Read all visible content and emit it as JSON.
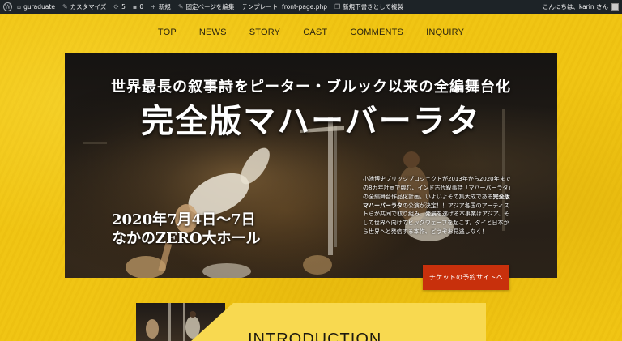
{
  "admin_bar": {
    "site_name": "guraduate",
    "customize": "カスタマイズ",
    "updates": "5",
    "comments": "0",
    "new": "新規",
    "edit_page": "固定ページを編集",
    "template": "テンプレート: front-page.php",
    "duplicate": "新規下書きとして複製",
    "greeting": "こんにちは、karin さん"
  },
  "nav": [
    "TOP",
    "NEWS",
    "STORY",
    "CAST",
    "COMMENTS",
    "INQUIRY"
  ],
  "hero": {
    "subtitle": "世界最長の叙事詩をピーター・ブルック以来の全編舞台化",
    "title": "完全版マハーバーラタ",
    "date_line1": "2020年7月4日〜7日",
    "date_line2": "なかのZERO大ホール",
    "desc_part1": "小池博史ブリッジプロジェクトが2013年から2020年までの8カ年計画で臨む、インド古代叙事詩「マハーバーラタ」の全編舞台作品化計画。いよいよその集大成である",
    "desc_bold": "完全版マハーバーラタ",
    "desc_part2": "の公演が決定！！アジア各国のアーティストらが共同で取り組み、発展を遂げる本事業はアジア、そして世界へ向けてビッグウェーブを起こす。タイと日本から世界へと発信する本作、どうぞお見逃しなく！"
  },
  "ticket_button": "チケットの予約サイトへ",
  "intro": {
    "heading": "INTRODUCTION"
  },
  "colors": {
    "background": "#f0c412",
    "adminbar": "#1d2327",
    "ticket": "#c8300c",
    "intro_card": "#f8d950"
  }
}
